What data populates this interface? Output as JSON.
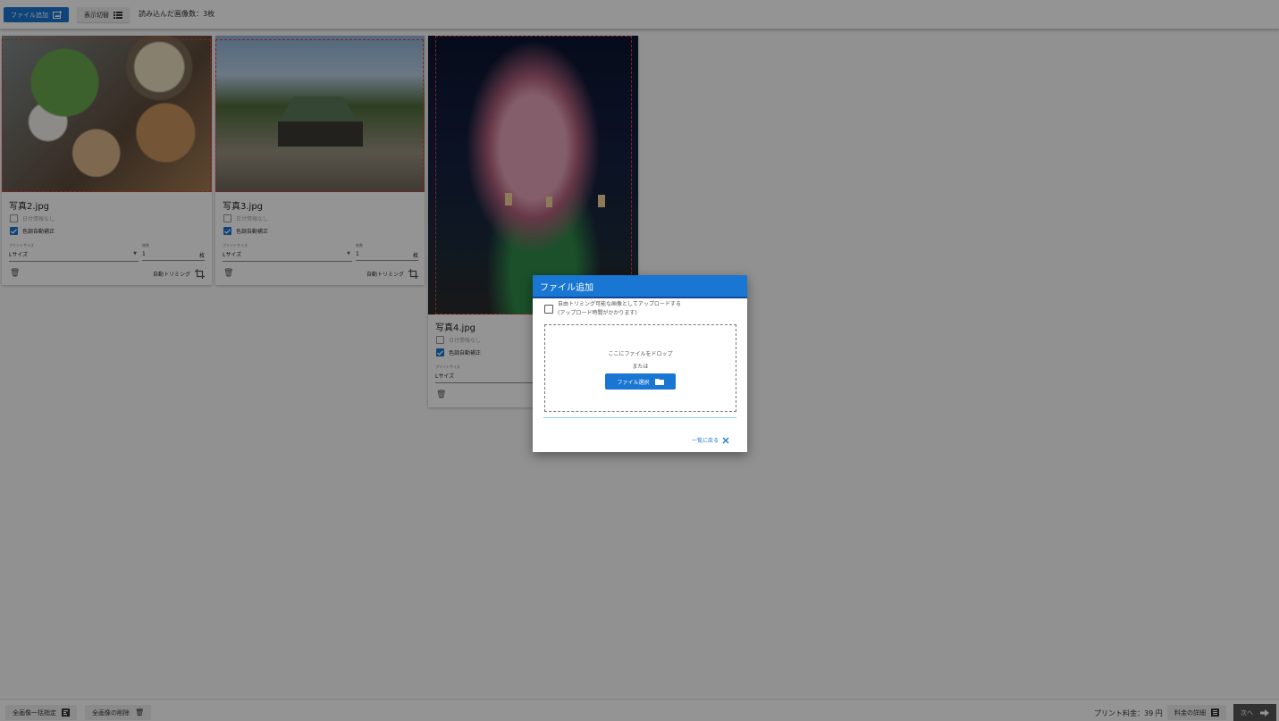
{
  "toolbar": {
    "add_file_label": "ファイル追加",
    "toggle_view_label": "表示切替",
    "loaded_count_text": "読み込んだ画像数：3枚"
  },
  "cards": [
    {
      "file_name": "写真2.jpg",
      "no_date_label": "日付情報なし",
      "color_correction_label": "色調自動補正",
      "print_size_label": "プリントサイズ",
      "print_size_value": "Lサイズ",
      "count_label": "枚数",
      "count_value": "1",
      "count_unit": "枚",
      "auto_trim_label": "自動トリミング"
    },
    {
      "file_name": "写真3.jpg",
      "no_date_label": "日付情報なし",
      "color_correction_label": "色調自動補正",
      "print_size_label": "プリントサイズ",
      "print_size_value": "Lサイズ",
      "count_label": "枚数",
      "count_value": "1",
      "count_unit": "枚",
      "auto_trim_label": "自動トリミング"
    },
    {
      "file_name": "写真4.jpg",
      "no_date_label": "日付情報なし",
      "color_correction_label": "色調自動補正",
      "print_size_label": "プリントサイズ",
      "print_size_value": "Lサイズ"
    }
  ],
  "bottom": {
    "bulk_set_label": "全画像一括指定",
    "delete_all_label": "全画像の削除",
    "price_text": "プリント料金：39 円",
    "price_detail_label": "料金の詳細",
    "next_label": "次へ"
  },
  "dialog": {
    "title": "ファイル追加",
    "option_line1": "自由トリミング可能な画像としてアップロードする",
    "option_line2": "(アップロード時間がかかります)",
    "drop_text": "ここにファイルをドロップ",
    "or_text": "または",
    "file_select_label": "ファイル選択",
    "back_label": "一覧に戻る"
  },
  "colors": {
    "primary": "#1976d2",
    "trim_border": "#e53935",
    "overlay": "rgba(0,0,0,0.42)"
  }
}
